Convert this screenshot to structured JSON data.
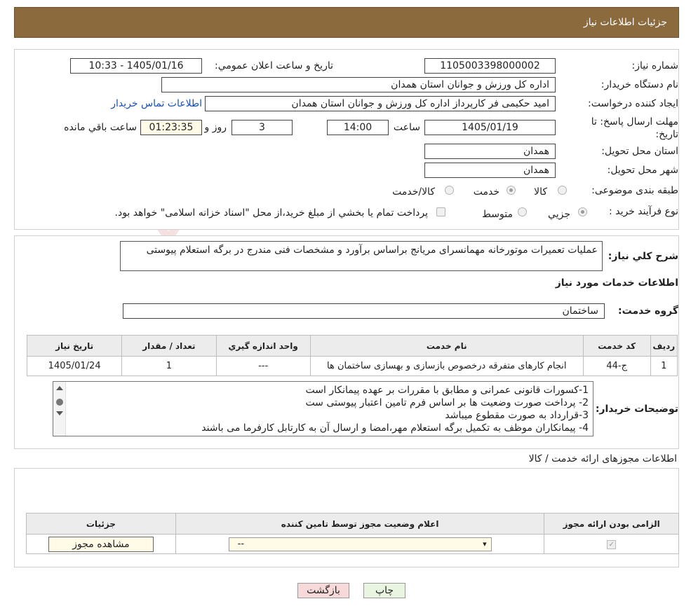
{
  "header": {
    "title": "جزئیات اطلاعات نیاز"
  },
  "watermark": {
    "text": "AriaTender.neT"
  },
  "form": {
    "need_number_label": "شماره نیاز:",
    "need_number": "1105003398000002",
    "announce_label": "تاریخ و ساعت اعلان عمومي:",
    "announce_value": "1405/01/16 - 10:33",
    "buyer_org_label": "نام دستگاه خريدار:",
    "buyer_org": "اداره كل ورزش و جوانان استان همدان",
    "creator_label": "ايجاد كننده درخواست:",
    "creator": "امید حکیمی فر کارپرداز اداره کل ورزش و جوانان استان همدان",
    "contact_link": "اطلاعات تماس خريدار",
    "deadline_label": "مهلت ارسال پاسخ: تا تاريخ:",
    "deadline_date": "1405/01/19",
    "time_label": "ساعت",
    "deadline_time": "14:00",
    "days_value": "3",
    "days_label": "روز و",
    "remaining_time": "01:23:35",
    "remaining_label": "ساعت باقي مانده",
    "province_label": "استان محل تحويل:",
    "province": "همدان",
    "city_label": "شهر محل تحويل:",
    "city": "همدان",
    "category_label": "طبقه بندی موضوعی:",
    "category_options": [
      "كالا",
      "خدمت",
      "كالا/خدمت"
    ],
    "process_label": "نوع فرآيند خريد :",
    "process_options": [
      "جزيي",
      "متوسط"
    ],
    "process_note": "پرداخت تمام يا بخشي از مبلغ خريد،از محل \"اسناد خزانه اسلامی\" خواهد بود."
  },
  "summary": {
    "label": "شرح كلي نياز:",
    "text": "عملیات تعمیرات موتورخانه مهمانسرای مریانج براساس برآورد و مشخصات فنی مندرج در برگه استعلام پیوستی",
    "services_title": "اطلاعات خدمات مورد نياز",
    "service_group_label": "گروه خدمت:",
    "service_group": "ساختمان"
  },
  "services_table": {
    "headers": [
      "رديف",
      "كد خدمت",
      "نام خدمت",
      "واحد اندازه گيري",
      "تعداد / مقدار",
      "تاريخ نياز"
    ],
    "rows": [
      [
        "1",
        "ج-44",
        "انجام کارهای متفرقه درخصوص بازسازی و بهسازی ساختمان ها",
        "---",
        "1",
        "1405/01/24"
      ]
    ]
  },
  "buyer_notes": {
    "label": "توضيحات خريدار:",
    "lines": [
      "1-کسورات قانونی عمرانی و مطابق با مقررات بر عهده پیمانکار است",
      "2- پرداخت صورت وضعیت ها بر اساس فرم تامین اعتبار پیوستی ست",
      "3-قرارداد به صورت مقطوع میباشد",
      "4- پیمانکاران موظف به تکمیل برگه استعلام مهر،امضا و ارسال آن به کارتابل کارفرما می باشند"
    ]
  },
  "permits": {
    "title": "اطلاعات مجوزهای ارائه خدمت / کالا",
    "headers": [
      "الزامی بودن ارائه مجوز",
      "اعلام وضعیت مجوز توسط تامین کننده",
      "جزئیات"
    ],
    "select_value": "--",
    "view_button": "مشاهده مجوز"
  },
  "actions": {
    "print": "چاپ",
    "back": "بازگشت"
  },
  "colors": {
    "header_bg": "#8b6a3e",
    "link": "#1a4fb5",
    "back_button_bg": "#f7d9d9",
    "print_button_bg": "#e9f5e1"
  }
}
